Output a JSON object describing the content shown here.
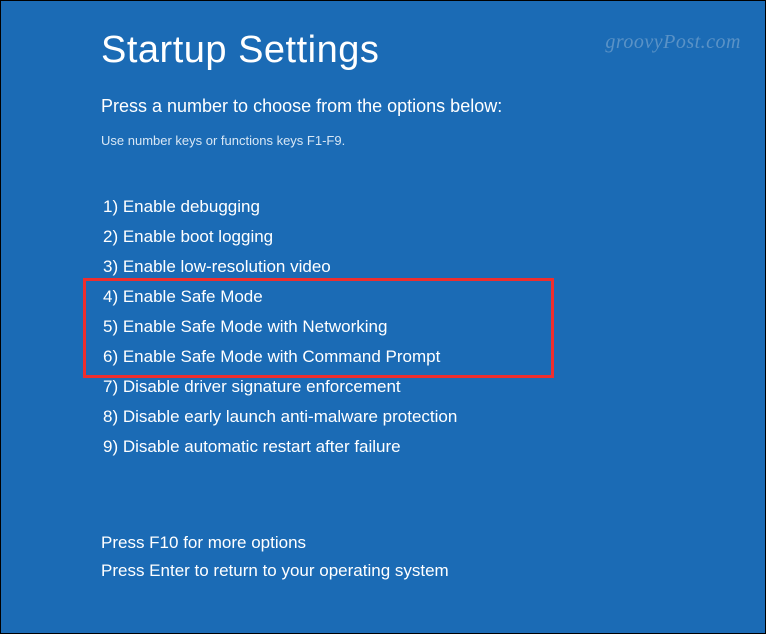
{
  "title": "Startup Settings",
  "subtitle": "Press a number to choose from the options below:",
  "hint": "Use number keys or functions keys F1-F9.",
  "options": [
    "1) Enable debugging",
    "2) Enable boot logging",
    "3) Enable low-resolution video",
    "4) Enable Safe Mode",
    "5) Enable Safe Mode with Networking",
    "6) Enable Safe Mode with Command Prompt",
    "7) Disable driver signature enforcement",
    "8) Disable early launch anti-malware protection",
    "9) Disable automatic restart after failure"
  ],
  "footer": {
    "line1": "Press F10 for more options",
    "line2": "Press Enter to return to your operating system"
  },
  "watermark": "groovyPost.com"
}
